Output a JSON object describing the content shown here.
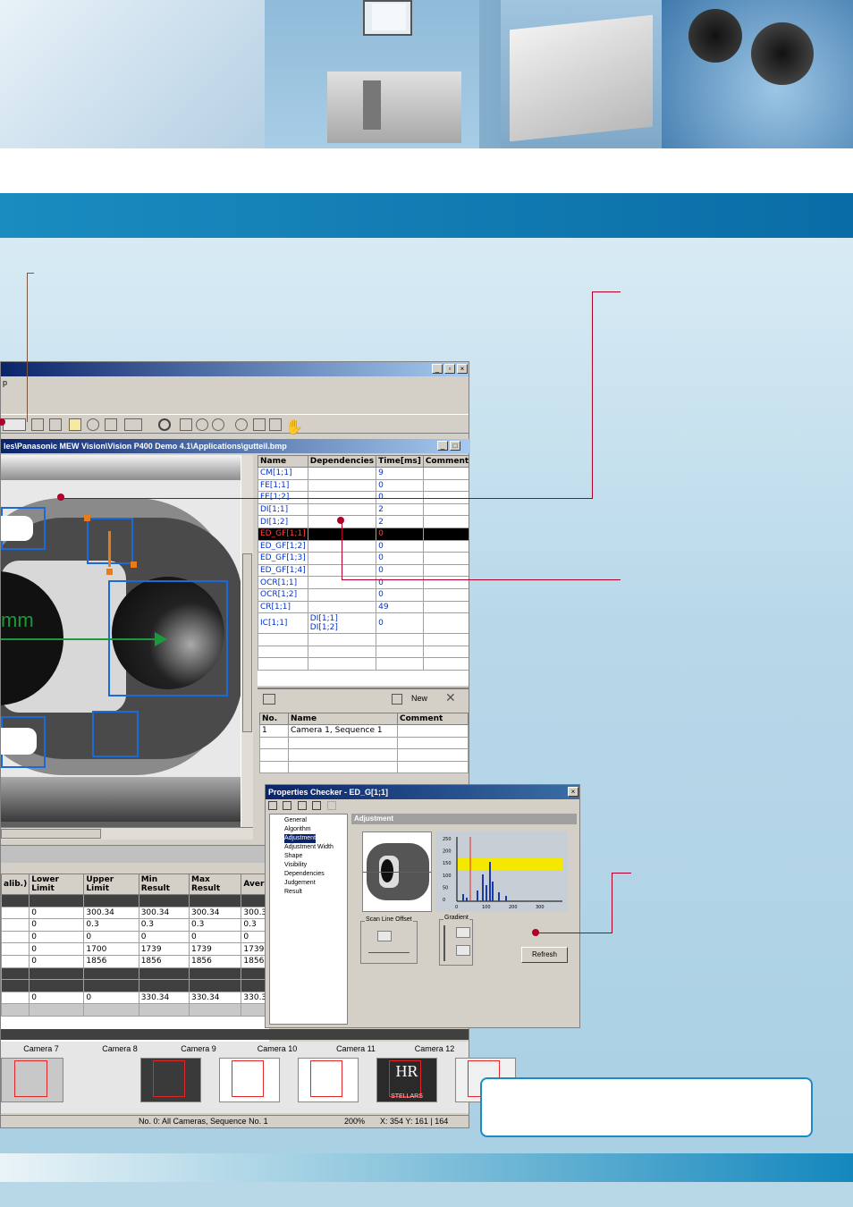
{
  "app": {
    "path_title": "les\\Panasonic MEW Vision\\Vision P400 Demo 4.1\\Applications\\gutteil.bmp",
    "menu_fragment": "p",
    "image_label": "mm"
  },
  "checker_table": {
    "headers": [
      "Name",
      "Dependencies",
      "Time[ms]",
      "Comment"
    ],
    "rows": [
      {
        "name": "CM[1;1]",
        "deps": "",
        "time": "9"
      },
      {
        "name": "FE[1;1]",
        "deps": "",
        "time": "0"
      },
      {
        "name": "FE[1;2]",
        "deps": "",
        "time": "0"
      },
      {
        "name": "DI[1;1]",
        "deps": "",
        "time": "2"
      },
      {
        "name": "DI[1;2]",
        "deps": "",
        "time": "2"
      },
      {
        "name": "ED_GF[1;1]",
        "deps": "",
        "time": "0",
        "selected": true
      },
      {
        "name": "ED_GF[1;2]",
        "deps": "",
        "time": "0"
      },
      {
        "name": "ED_GF[1;3]",
        "deps": "",
        "time": "0"
      },
      {
        "name": "ED_GF[1;4]",
        "deps": "",
        "time": "0"
      },
      {
        "name": "OCR[1;1]",
        "deps": "",
        "time": "0"
      },
      {
        "name": "OCR[1;2]",
        "deps": "",
        "time": "0"
      },
      {
        "name": "CR[1;1]",
        "deps": "",
        "time": "49"
      },
      {
        "name": "IC[1;1]",
        "deps": "DI[1;1]\nDI[1;2]",
        "time": "0"
      }
    ]
  },
  "sequence_panel": {
    "new_label": "New",
    "headers": [
      "No.",
      "Name",
      "Comment"
    ],
    "row": {
      "no": "1",
      "name": "Camera  1, Sequence  1"
    }
  },
  "results_table": {
    "headers": [
      "alib.)",
      "Lower Limit",
      "Upper Limit",
      "Min Result",
      "Max Result",
      "Averag"
    ],
    "rows": [
      [
        "",
        "0",
        "300.34",
        "300.34",
        "300.34",
        "300.3"
      ],
      [
        "",
        "0",
        "0.3",
        "0.3",
        "0.3",
        "0.3"
      ],
      [
        "",
        "0",
        "0",
        "0",
        "0",
        "0"
      ],
      [
        "",
        "0",
        "1700",
        "1739",
        "1739",
        "1739"
      ],
      [
        "",
        "0",
        "1856",
        "1856",
        "1856",
        "1856"
      ],
      [
        "",
        "0",
        "0",
        "330.34",
        "330.34",
        "330.3"
      ]
    ]
  },
  "cameras": [
    "Camera  7",
    "Camera  8",
    "Camera  9",
    "Camera 10",
    "Camera 11",
    "Camera 12"
  ],
  "thumb11_letters": "HR",
  "thumb11_caption": "STELLARS",
  "statusbar": {
    "sequence": "No. 0: All Cameras, Sequence No. 1",
    "zoom": "200%",
    "coords": "X: 354  Y: 161 | 164"
  },
  "properties_checker": {
    "title": "Properties Checker - ED_G[1;1]",
    "tree": [
      "General",
      "Algorithm",
      "Adjustment",
      "Adjustment Width",
      "Shape",
      "Visibility",
      "Dependencies",
      "Judgement",
      "Result"
    ],
    "selected_tree_item": "Adjustment",
    "panel_title": "Adjustment",
    "scan_line_offset_label": "Scan Line Offset",
    "gradient_label": "Gradient",
    "refresh_label": "Refresh",
    "histogram_y_ticks": [
      "250",
      "200",
      "150",
      "100",
      "50",
      "0"
    ],
    "histogram_x_ticks": [
      "0",
      "100",
      "200",
      "300"
    ]
  },
  "colors": {
    "accent_blue": "#0a6ca6",
    "callout_red": "#b0002a",
    "overlay_orange": "#e87b1c",
    "overlay_green": "#1a9a3a",
    "overlay_blue": "#1a6ad8"
  }
}
